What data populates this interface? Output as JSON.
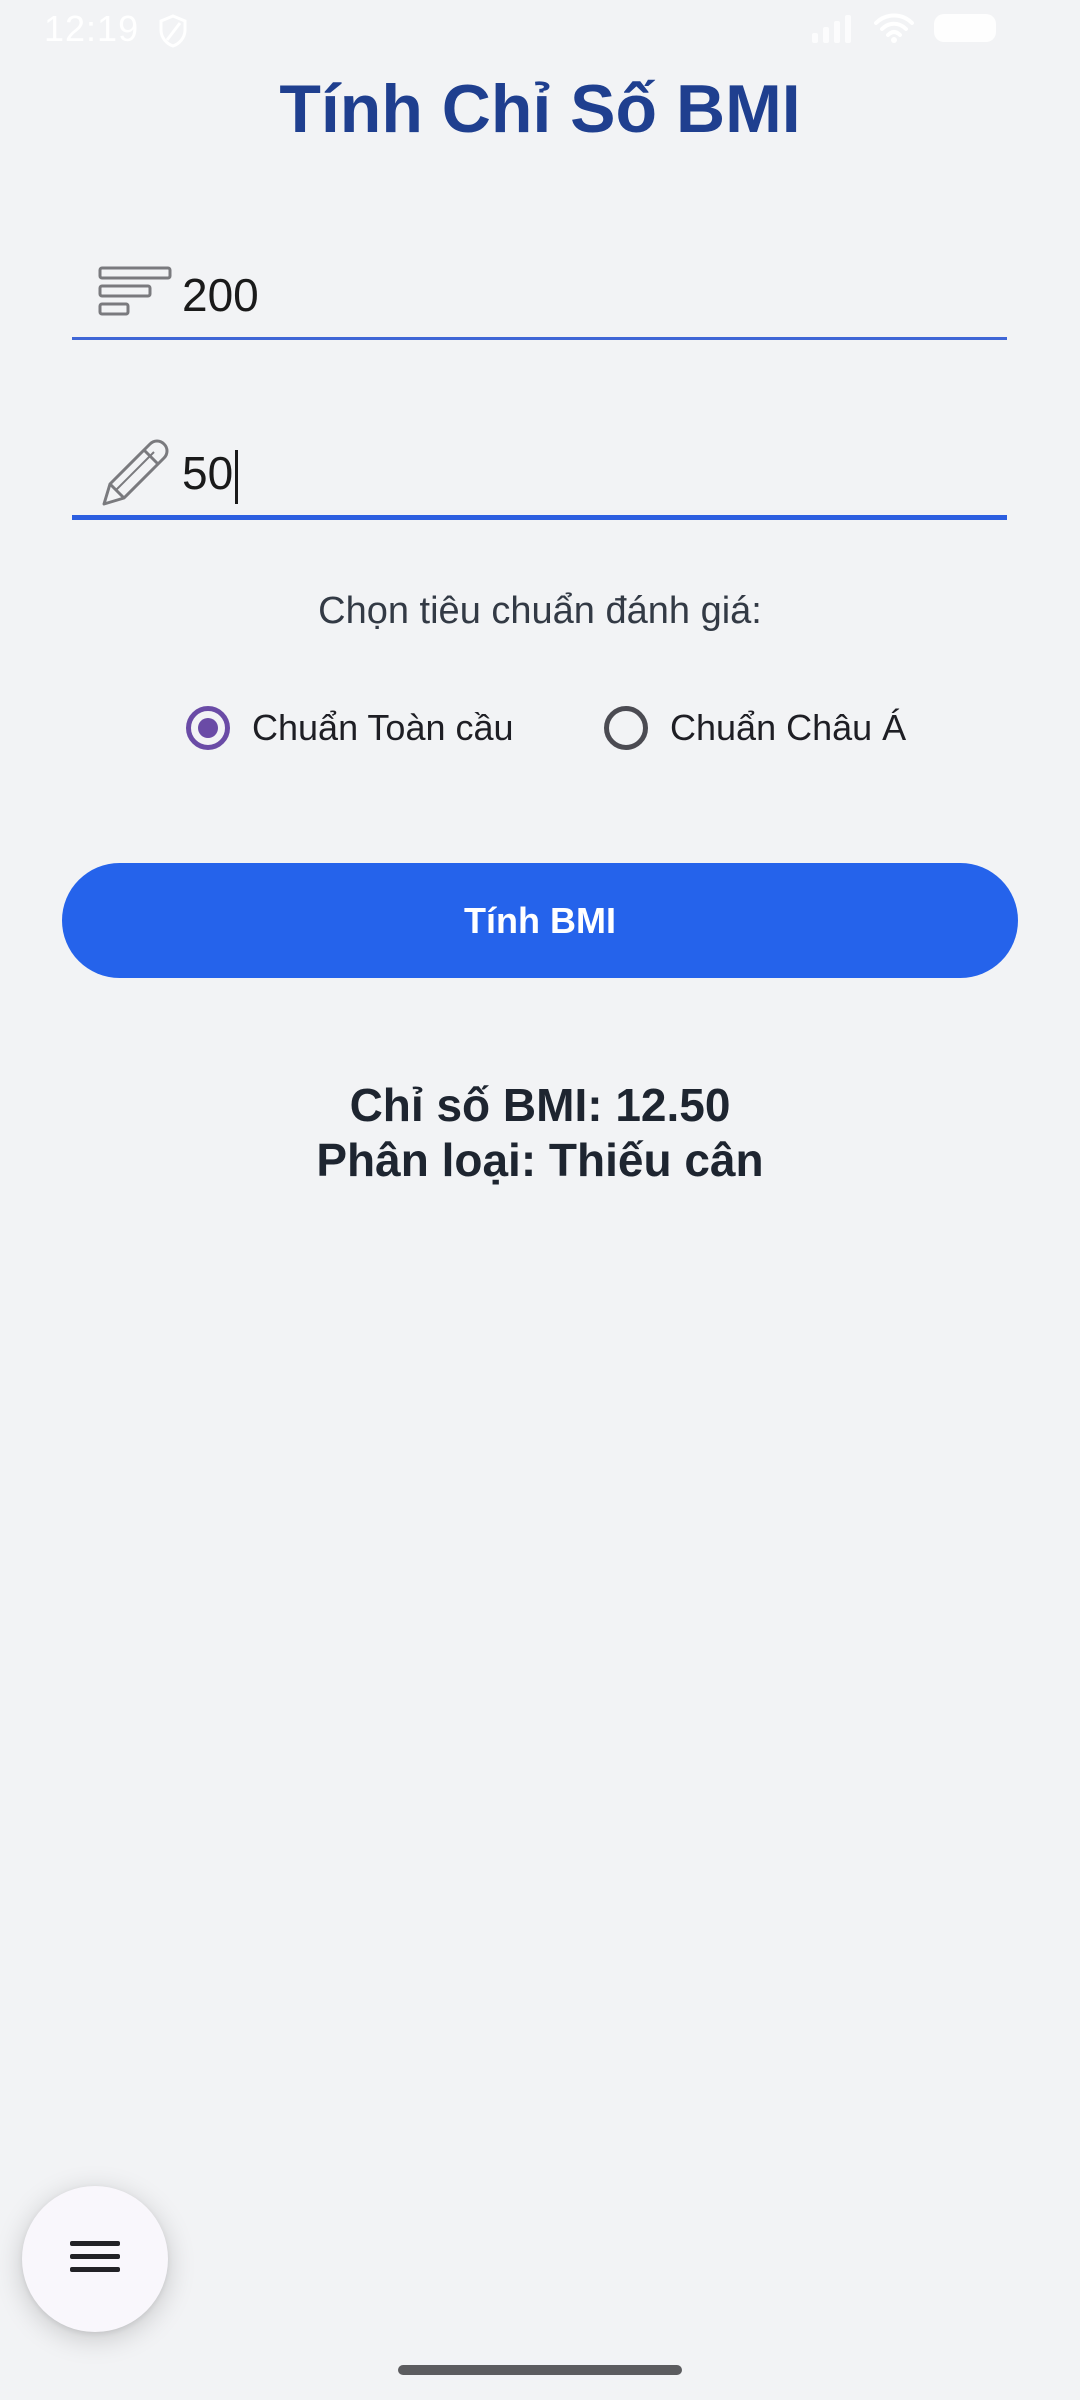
{
  "status_bar": {
    "time": "12:19"
  },
  "title": "Tính Chỉ Số BMI",
  "height_field": {
    "value": "200",
    "icon": "sort-lines-icon"
  },
  "weight_field": {
    "value": "50",
    "icon": "pencil-icon"
  },
  "criteria": {
    "label": "Chọn tiêu chuẩn đánh giá:",
    "options": [
      {
        "label": "Chuẩn Toàn cầu",
        "selected": true
      },
      {
        "label": "Chuẩn Châu Á",
        "selected": false
      }
    ]
  },
  "calculate_button": {
    "label": "Tính BMI"
  },
  "result": {
    "bmi_line": "Chỉ số BMI: 12.50",
    "category_line": "Phân loại: Thiếu cân"
  },
  "colors": {
    "title": "#1f3f8f",
    "primary": "#2563eb",
    "radio_selected": "#6a4ba6",
    "background": "#f2f3f5"
  }
}
